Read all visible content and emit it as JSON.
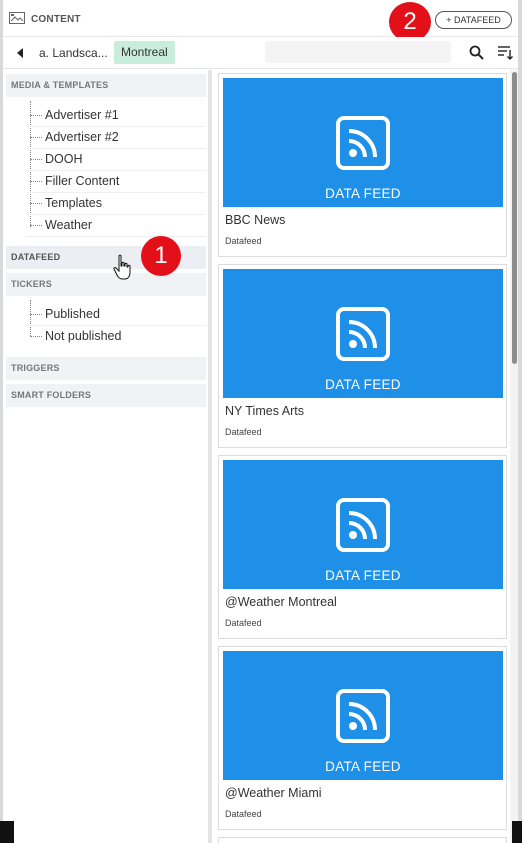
{
  "header": {
    "title": "CONTENT",
    "add_button": "+ DATAFEED"
  },
  "toolbar": {
    "breadcrumb": "a. Landsca...",
    "filter_tag": "Montreal",
    "search_placeholder": ""
  },
  "callouts": [
    "1",
    "2"
  ],
  "sidebar": {
    "sections": {
      "media": "MEDIA & TEMPLATES",
      "datafeed": "DATAFEED",
      "tickers": "TICKERS",
      "triggers": "TRIGGERS",
      "smart_folders": "SMART FOLDERS"
    },
    "media_items": [
      "Advertiser #1",
      "Advertiser #2",
      "DOOH",
      "Filler Content",
      "Templates",
      "Weather"
    ],
    "ticker_items": [
      "Published",
      "Not published"
    ]
  },
  "feeds": [
    {
      "thumb_label": "DATA FEED",
      "title": "BBC News",
      "type": "Datafeed"
    },
    {
      "thumb_label": "DATA FEED",
      "title": "NY Times Arts",
      "type": "Datafeed"
    },
    {
      "thumb_label": "DATA FEED",
      "title": "@Weather Montreal",
      "type": "Datafeed"
    },
    {
      "thumb_label": "DATA FEED",
      "title": "@Weather Miami",
      "type": "Datafeed"
    }
  ],
  "colors": {
    "thumb_blue": "#1e90e8",
    "tag_green": "#c8ecdd",
    "callout_red": "#e3101a"
  },
  "icons": [
    "content-icon",
    "back-arrow-icon",
    "search-icon",
    "sort-icon",
    "rss-icon",
    "pointer-cursor-icon"
  ]
}
